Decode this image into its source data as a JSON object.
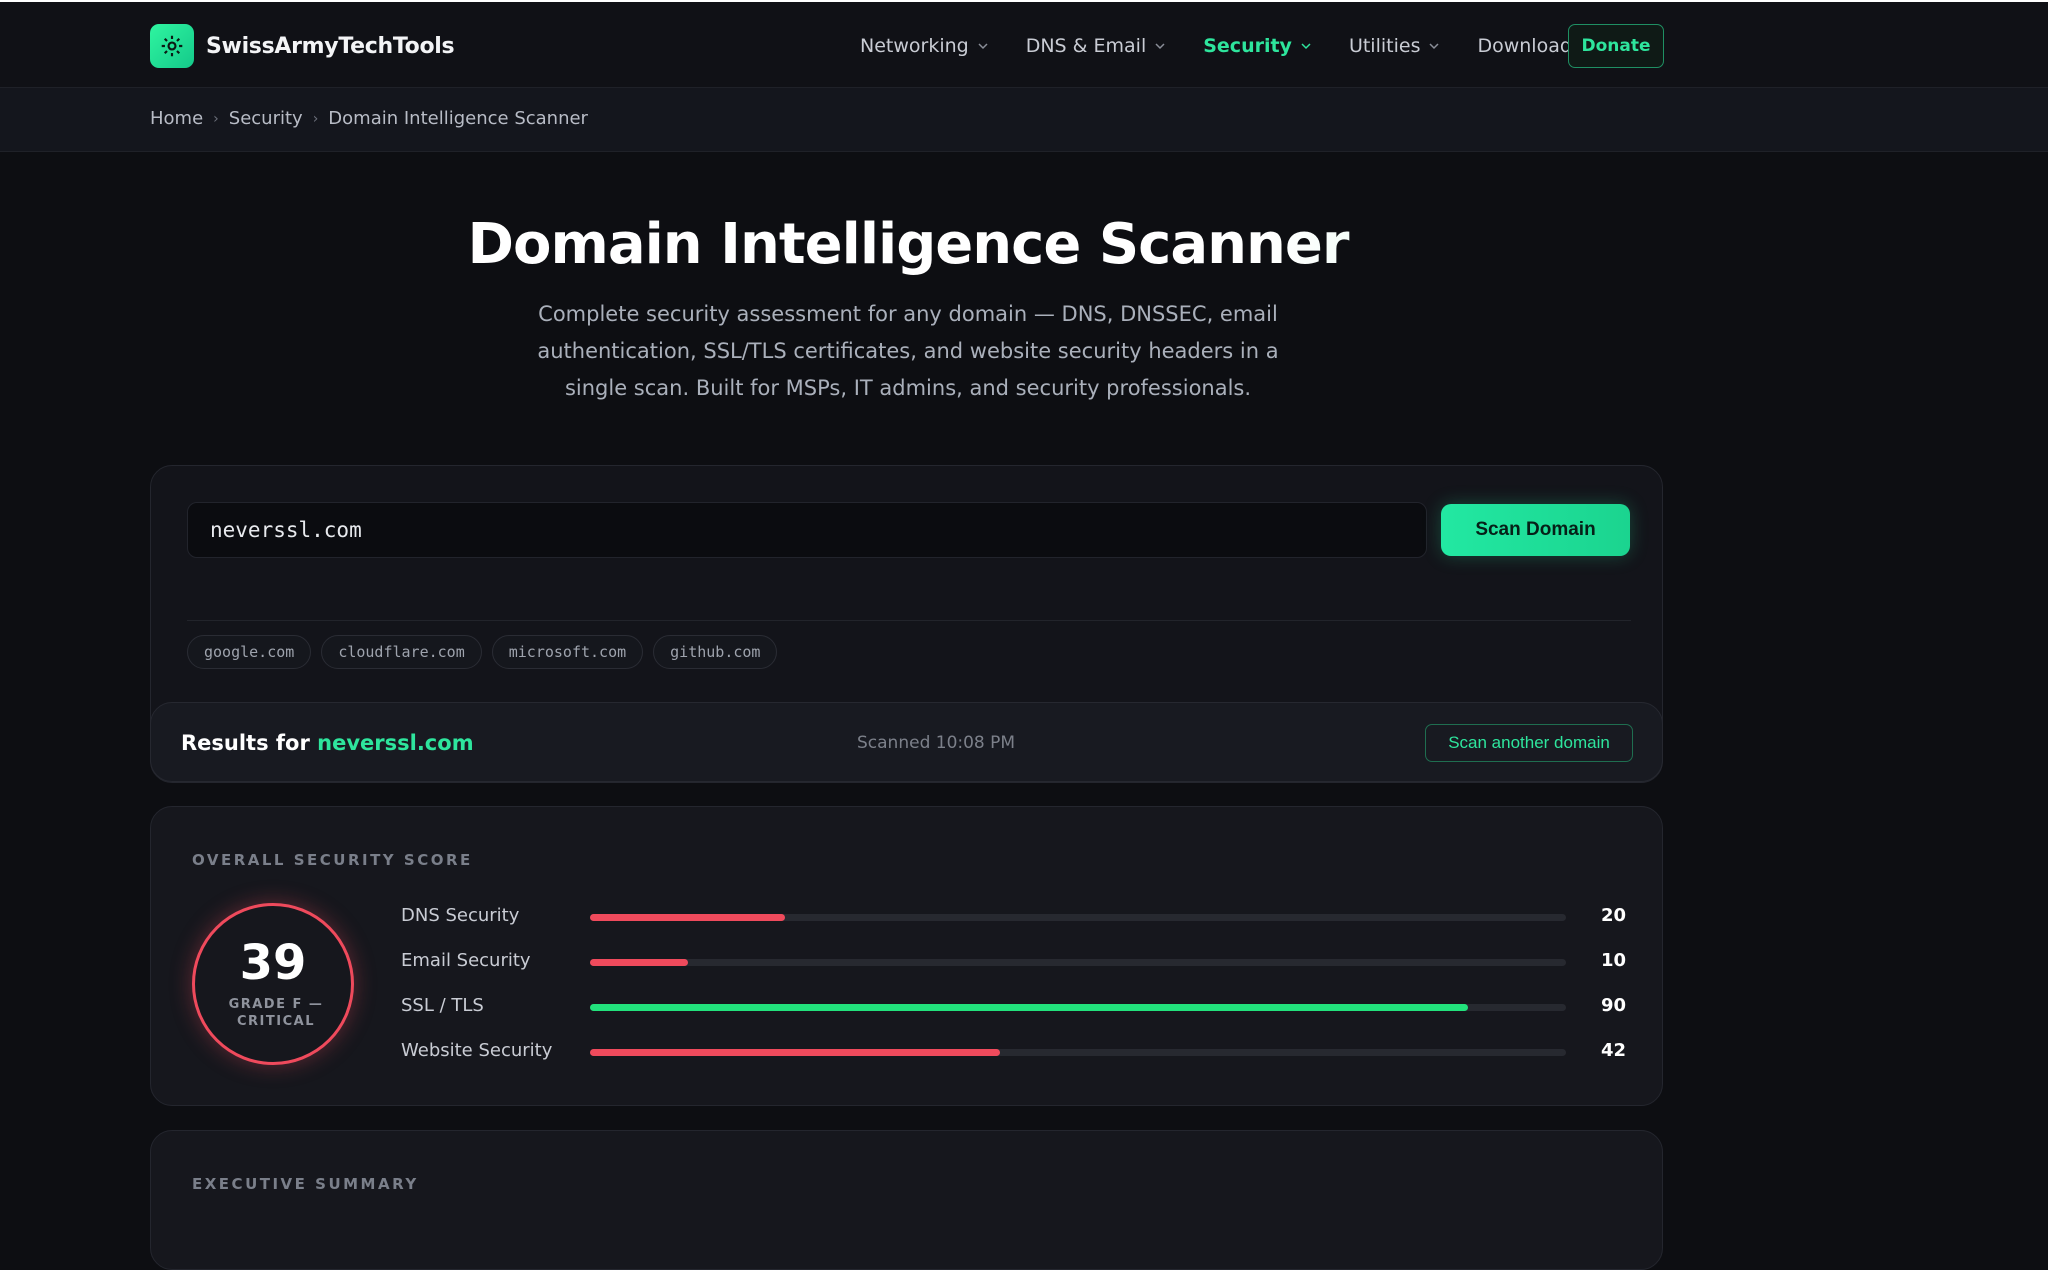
{
  "brand": {
    "name": "SwissArmyTechTools",
    "icon": "gear-icon"
  },
  "nav": {
    "items": [
      {
        "label": "Networking",
        "active": false
      },
      {
        "label": "DNS & Email",
        "active": false
      },
      {
        "label": "Security",
        "active": true
      },
      {
        "label": "Utilities",
        "active": false
      },
      {
        "label": "Downloads",
        "active": false
      }
    ],
    "donate_label": "Donate"
  },
  "breadcrumb": {
    "home": "Home",
    "section": "Security",
    "current": "Domain Intelligence Scanner"
  },
  "hero": {
    "title": "Domain Intelligence Scanner",
    "subtitle": "Complete security assessment for any domain — DNS, DNSSEC, email authentication, SSL/TLS certificates, and website security headers in a single scan. Built for MSPs, IT admins, and security professionals."
  },
  "scan": {
    "input_value": "neverssl.com",
    "button_label": "Scan Domain",
    "examples": [
      "google.com",
      "cloudflare.com",
      "microsoft.com",
      "github.com"
    ]
  },
  "results": {
    "prefix": "Results for ",
    "domain": "neverssl.com",
    "scanned_at": "Scanned 10:08 PM",
    "scan_another_label": "Scan another domain"
  },
  "score": {
    "section_label": "OVERALL SECURITY SCORE",
    "overall": "39",
    "grade": "GRADE F — CRITICAL",
    "metrics": [
      {
        "label": "DNS Security",
        "value": 20,
        "color": "#ef4a5c"
      },
      {
        "label": "Email Security",
        "value": 10,
        "color": "#ef4a5c"
      },
      {
        "label": "SSL / TLS",
        "value": 90,
        "color": "#22e27c"
      },
      {
        "label": "Website Security",
        "value": 42,
        "color": "#ef4a5c"
      }
    ]
  },
  "summary": {
    "section_label": "EXECUTIVE SUMMARY"
  },
  "colors": {
    "accent": "#2ee59d",
    "danger": "#ef4a5c",
    "success": "#22e27c"
  }
}
